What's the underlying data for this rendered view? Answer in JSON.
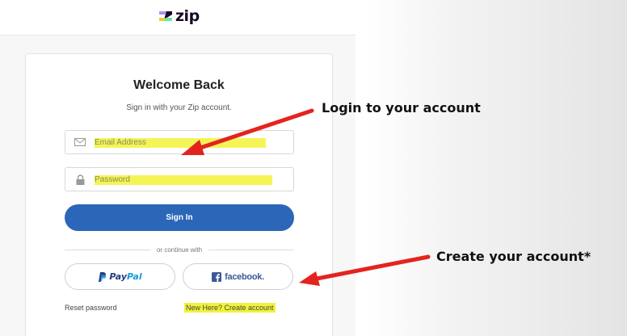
{
  "logo": {
    "text": "zip"
  },
  "card": {
    "title": "Welcome Back",
    "subtitle": "Sign in with your Zip account."
  },
  "form": {
    "email_placeholder": "Email Address",
    "password_placeholder": "Password",
    "signin_label": "Sign In",
    "divider_text": "or continue with"
  },
  "social": {
    "paypal_a": "Pay",
    "paypal_b": "Pal",
    "facebook": "facebook."
  },
  "links": {
    "reset": "Reset password",
    "create": "New Here? Create account"
  },
  "annotations": {
    "login": "Login to your account",
    "create": "Create your account*"
  },
  "colors": {
    "primary": "#2c66b8",
    "highlight": "#f2f23a",
    "arrow": "#e3241e",
    "paypal_dark": "#253b80",
    "paypal_light": "#179bd7",
    "facebook": "#3b5998"
  }
}
